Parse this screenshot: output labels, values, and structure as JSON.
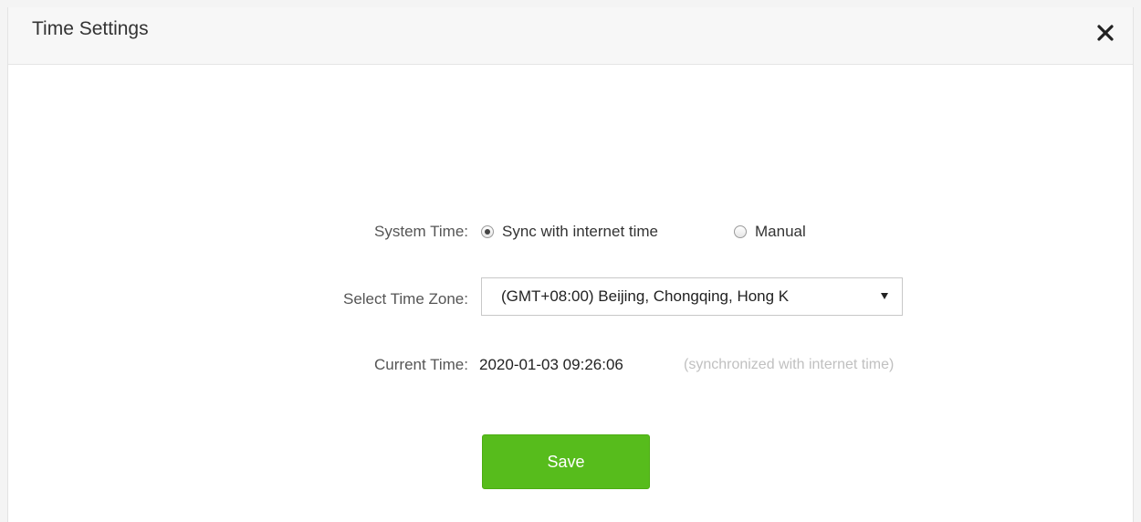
{
  "dialog": {
    "title": "Time Settings",
    "close_icon": "close-icon"
  },
  "system_time": {
    "label": "System Time:",
    "options": [
      {
        "label": "Sync with internet time",
        "checked": true
      },
      {
        "label": "Manual",
        "checked": false
      }
    ]
  },
  "time_zone": {
    "label": "Select Time Zone:",
    "selected": "(GMT+08:00) Beijing, Chongqing, Hong K"
  },
  "current_time": {
    "label": "Current Time:",
    "value": "2020-01-03 09:26:06",
    "note": "(synchronized with internet time)"
  },
  "actions": {
    "save_label": "Save"
  },
  "colors": {
    "save_button": "#57bc1c",
    "header_bg": "#f7f7f7"
  }
}
